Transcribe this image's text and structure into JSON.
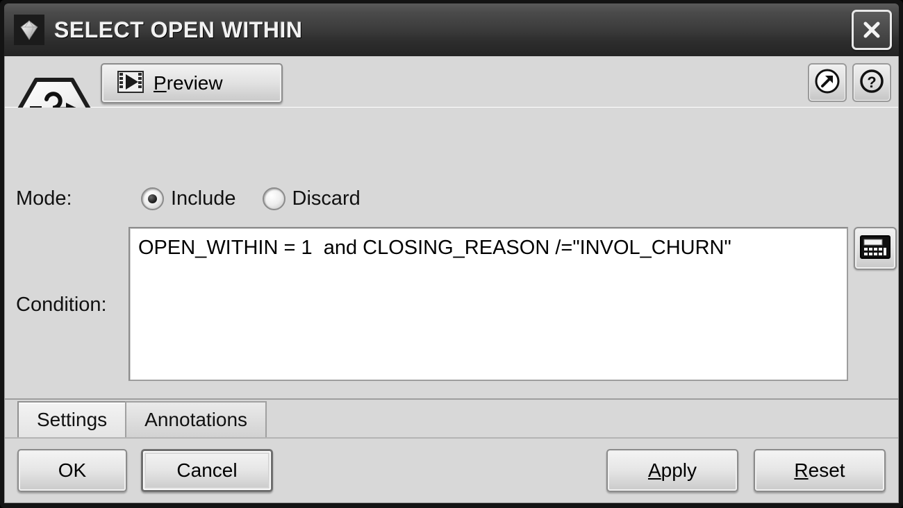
{
  "window": {
    "title": "SELECT OPEN WITHIN",
    "title_icon": "gem-icon",
    "close_label": "✕"
  },
  "node": {
    "icon": "select-node-hexagon-icon"
  },
  "toolbar": {
    "preview_label_mnemonic": "P",
    "preview_label_rest": "review",
    "preview_icon": "film-play-icon",
    "expand_icon": "arrow-up-right-circle-icon",
    "help_icon": "question-circle-icon"
  },
  "settings": {
    "mode_label": "Mode:",
    "mode_options": [
      {
        "label": "Include",
        "selected": true
      },
      {
        "label": "Discard",
        "selected": false
      }
    ],
    "condition_label": "Condition:",
    "condition_value": "OPEN_WITHIN = 1  and CLOSING_REASON /=\"INVOL_CHURN\"",
    "expression_builder_icon": "calculator-icon"
  },
  "tabs": [
    {
      "label": "Settings",
      "active": true
    },
    {
      "label": "Annotations",
      "active": false
    }
  ],
  "footer": {
    "ok_label": "OK",
    "cancel_label": "Cancel",
    "apply_label_mnemonic": "A",
    "apply_label_rest": "pply",
    "reset_label_mnemonic": "R",
    "reset_label_rest": "eset"
  },
  "colors": {
    "titlebar_dark": "#2d2d2d",
    "dialog_face": "#d8d8d8",
    "field_bg": "#ffffff",
    "frame_black": "#141414"
  }
}
